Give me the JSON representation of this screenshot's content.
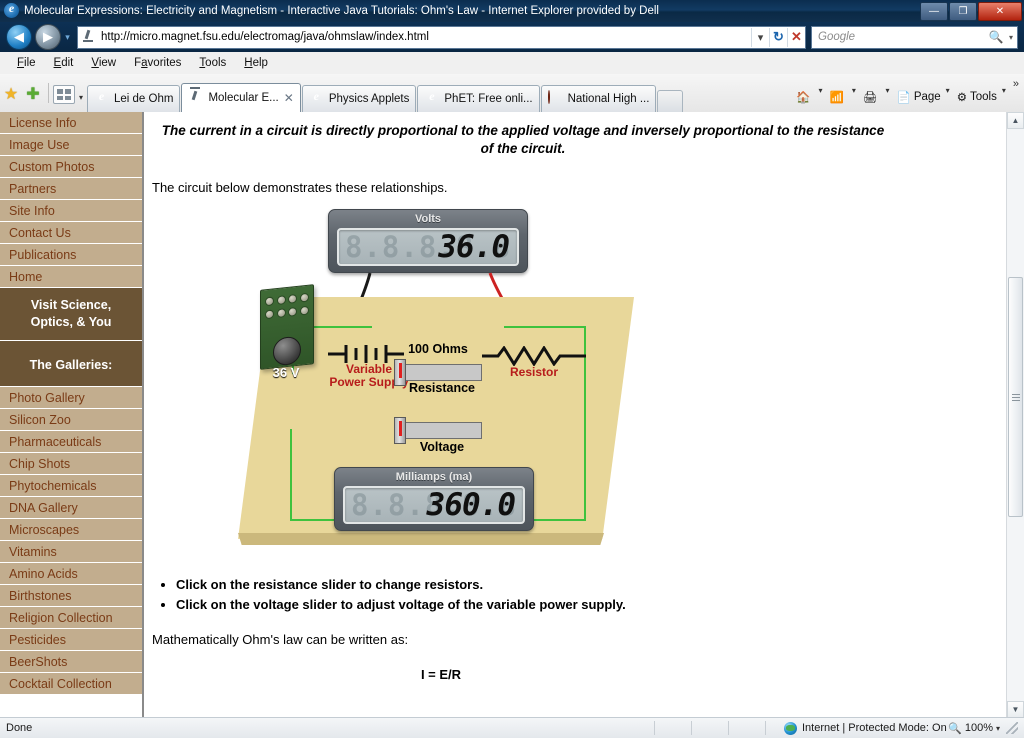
{
  "window": {
    "title": "Molecular Expressions: Electricity and Magnetism - Interactive Java Tutorials: Ohm's Law - Internet Explorer provided by Dell",
    "minimize": "—",
    "maximize": "❐",
    "close": "✕"
  },
  "nav": {
    "back": "◀",
    "forward": "▶",
    "history_dropdown": "▾",
    "url": "http://micro.magnet.fsu.edu/electromag/java/ohmslaw/index.html",
    "url_dropdown": "▾",
    "refresh": "↻",
    "stop": "✕",
    "search_placeholder": "Google",
    "search_dropdown": "▾"
  },
  "menu": {
    "items": [
      {
        "first": "F",
        "rest": "ile"
      },
      {
        "first": "E",
        "rest": "dit"
      },
      {
        "first": "V",
        "rest": "iew"
      },
      {
        "first": "F",
        "rest": "avorites",
        "pre": ""
      },
      {
        "first": "T",
        "rest": "ools"
      },
      {
        "first": "H",
        "rest": "elp"
      }
    ],
    "labels": [
      "File",
      "Edit",
      "View",
      "Favorites",
      "Tools",
      "Help"
    ]
  },
  "toolbar": {
    "favorites_star": "★",
    "add_favorite": "✚",
    "quicktabs_dropdown": "▾",
    "home_label": "",
    "feeds_label": "",
    "print_label": "",
    "page_label": "Page",
    "tools_label": "Tools",
    "dropdown": "▾",
    "overflow": "»"
  },
  "tabs": [
    {
      "label": "Lei de Ohm",
      "icon": "ie-logo-icon",
      "active": false
    },
    {
      "label": "Molecular E...",
      "icon": "microscope-icon",
      "active": true,
      "close": "✕"
    },
    {
      "label": "Physics Applets",
      "icon": "ie-logo-icon",
      "active": false
    },
    {
      "label": "PhET: Free onli...",
      "icon": "ie-logo-icon",
      "active": false
    },
    {
      "label": "National High ...",
      "icon": "nhmfl-icon",
      "active": false
    }
  ],
  "sidebar": {
    "top_links": [
      "License Info",
      "Image Use",
      "Custom Photos",
      "Partners",
      "Site Info",
      "Contact Us",
      "Publications",
      "Home"
    ],
    "banner1_line1": "Visit Science,",
    "banner1_line2": "Optics, & You",
    "banner2": "The Galleries:",
    "gallery_links": [
      "Photo Gallery",
      "Silicon Zoo",
      "Pharmaceuticals",
      "Chip Shots",
      "Phytochemicals",
      "DNA Gallery",
      "Microscapes",
      "Vitamins",
      "Amino Acids",
      "Birthstones",
      "Religion Collection",
      "Pesticides",
      "BeerShots",
      "Cocktail Collection"
    ]
  },
  "content": {
    "quote_line1": "The current in a circuit is directly proportional to the applied voltage and inversely",
    "quote_line2": "proportional to the resistance of the circuit.",
    "intro": "The circuit below demonstrates these relationships.",
    "bullets": [
      "Click on the resistance slider to change resistors.",
      "Click on the voltage slider to adjust voltage of the variable power supply."
    ],
    "math_intro": "Mathematically Ohm's law can be written as:",
    "formula": "I = E/R"
  },
  "applet": {
    "voltmeter": {
      "title": "Volts",
      "value": "36.0",
      "ghost": "8.8.8.8.8.8."
    },
    "ammeter": {
      "title": "Milliamps (ma)",
      "value": "360.0",
      "ghost": "8.8.8.8.8.8."
    },
    "resistor_value": "100 Ohms",
    "power_supply_label_line1": "Variable",
    "power_supply_label_line2": "Power Supply",
    "resistor_label": "Resistor",
    "resistance_slider_label": "Resistance",
    "voltage_slider_label": "Voltage",
    "psu_voltage": "36 V",
    "colors": {
      "board": "#e8d79a",
      "wire": "#3ec23e",
      "label_red": "#b71c1c",
      "psu_green": "#3f6b36"
    }
  },
  "statusbar": {
    "status": "Done",
    "zone": "Internet | Protected Mode: On",
    "zoom": "100%",
    "zoom_dropdown": "▾"
  },
  "scrollbar": {
    "up_arrow": "▲",
    "down_arrow": "▼"
  }
}
